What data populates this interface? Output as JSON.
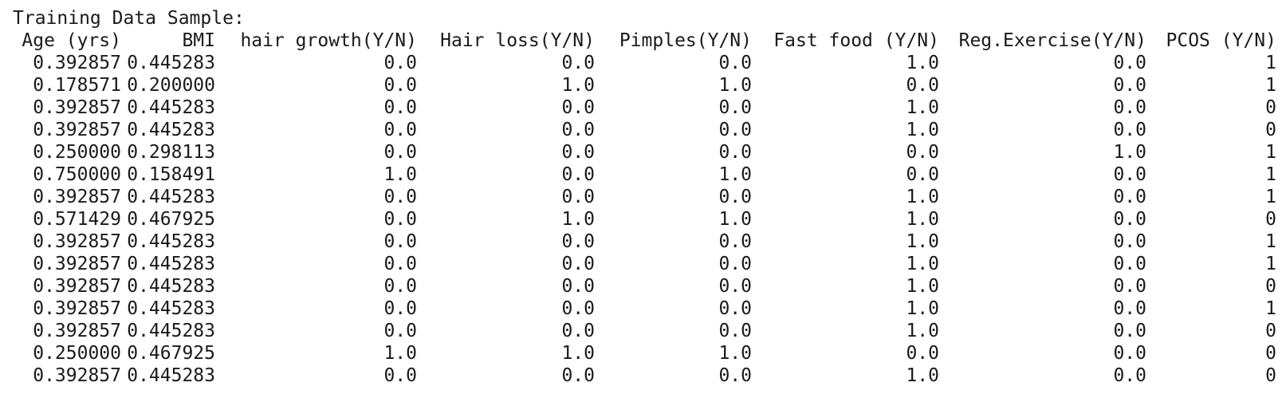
{
  "title": "Training Data Sample:",
  "columns": [
    "Age (yrs)",
    "BMI",
    "hair growth(Y/N)",
    "Hair loss(Y/N)",
    "Pimples(Y/N)",
    "Fast food (Y/N)",
    "Reg.Exercise(Y/N)",
    "PCOS (Y/N)"
  ],
  "rows": [
    [
      "0.392857",
      "0.445283",
      "0.0",
      "0.0",
      "0.0",
      "1.0",
      "0.0",
      "1"
    ],
    [
      "0.178571",
      "0.200000",
      "0.0",
      "1.0",
      "1.0",
      "0.0",
      "0.0",
      "1"
    ],
    [
      "0.392857",
      "0.445283",
      "0.0",
      "0.0",
      "0.0",
      "1.0",
      "0.0",
      "0"
    ],
    [
      "0.392857",
      "0.445283",
      "0.0",
      "0.0",
      "0.0",
      "1.0",
      "0.0",
      "0"
    ],
    [
      "0.250000",
      "0.298113",
      "0.0",
      "0.0",
      "0.0",
      "0.0",
      "1.0",
      "1"
    ],
    [
      "0.750000",
      "0.158491",
      "1.0",
      "0.0",
      "1.0",
      "0.0",
      "0.0",
      "1"
    ],
    [
      "0.392857",
      "0.445283",
      "0.0",
      "0.0",
      "0.0",
      "1.0",
      "0.0",
      "1"
    ],
    [
      "0.571429",
      "0.467925",
      "0.0",
      "1.0",
      "1.0",
      "1.0",
      "0.0",
      "0"
    ],
    [
      "0.392857",
      "0.445283",
      "0.0",
      "0.0",
      "0.0",
      "1.0",
      "0.0",
      "1"
    ],
    [
      "0.392857",
      "0.445283",
      "0.0",
      "0.0",
      "0.0",
      "1.0",
      "0.0",
      "1"
    ],
    [
      "0.392857",
      "0.445283",
      "0.0",
      "0.0",
      "0.0",
      "1.0",
      "0.0",
      "0"
    ],
    [
      "0.392857",
      "0.445283",
      "0.0",
      "0.0",
      "0.0",
      "1.0",
      "0.0",
      "1"
    ],
    [
      "0.392857",
      "0.445283",
      "0.0",
      "0.0",
      "0.0",
      "1.0",
      "0.0",
      "0"
    ],
    [
      "0.250000",
      "0.467925",
      "1.0",
      "1.0",
      "1.0",
      "0.0",
      "0.0",
      "0"
    ],
    [
      "0.392857",
      "0.445283",
      "0.0",
      "0.0",
      "0.0",
      "1.0",
      "0.0",
      "0"
    ]
  ]
}
